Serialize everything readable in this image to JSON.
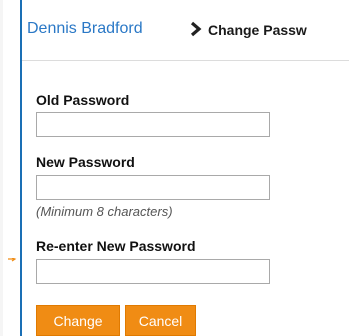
{
  "breadcrumb": {
    "user_name": "Dennis Bradford",
    "separator_icon": "chevron-right-icon",
    "current_page": "Change Passw"
  },
  "form": {
    "old_password": {
      "label": "Old Password",
      "value": ""
    },
    "new_password": {
      "label": "New Password",
      "value": "",
      "hint": "(Minimum 8 characters)"
    },
    "reenter_password": {
      "label": "Re-enter New Password",
      "value": ""
    }
  },
  "actions": {
    "change_label": "Change",
    "cancel_label": "Cancel"
  },
  "colors": {
    "accent": "#f08c14",
    "link": "#2a78c6",
    "border": "#1a6fb5"
  }
}
